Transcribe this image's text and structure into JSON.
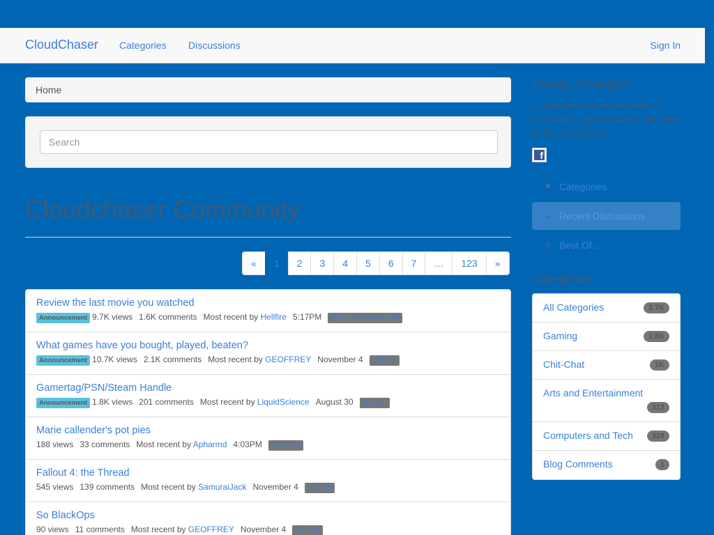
{
  "navbar": {
    "brand": "CloudChaser",
    "links": [
      "Categories",
      "Discussions"
    ],
    "signin": "Sign In"
  },
  "breadcrumb": "Home",
  "search": {
    "placeholder": "Search"
  },
  "page_title": "Cloudchaser Community",
  "pager": [
    "«",
    "1",
    "2",
    "3",
    "4",
    "5",
    "6",
    "7",
    "…",
    "123",
    "»"
  ],
  "discussions": [
    {
      "title": "Review the last movie you watched",
      "announcement": "Announcement",
      "views": "9.7K views",
      "comments": "1.6K comments",
      "recent_prefix": "Most recent by",
      "user": "Hellfire",
      "time": "5:17PM",
      "category": "Arts and Entertainment"
    },
    {
      "title": "What games have you bought, played, beaten?",
      "announcement": "Announcement",
      "views": "10.7K views",
      "comments": "2.1K comments",
      "recent_prefix": "Most recent by",
      "user": "GEOFFREY",
      "time": "November 4",
      "category": "Gaming"
    },
    {
      "title": "Gamertag/PSN/Steam Handle",
      "announcement": "Announcement",
      "views": "1.8K views",
      "comments": "201 comments",
      "recent_prefix": "Most recent by",
      "user": "LiquidScience",
      "time": "August 30",
      "category": "Gaming"
    },
    {
      "title": "Marie callender's pot pies",
      "announcement": "",
      "views": "188 views",
      "comments": "33 comments",
      "recent_prefix": "Most recent by",
      "user": "Apharmd",
      "time": "4:03PM",
      "category": "Chit-Chat"
    },
    {
      "title": "Fallout 4: the Thread",
      "announcement": "",
      "views": "545 views",
      "comments": "139 comments",
      "recent_prefix": "Most recent by",
      "user": "SamuraiJack",
      "time": "November 4",
      "category": "Gaming"
    },
    {
      "title": "So BlackOps",
      "announcement": "",
      "views": "90 views",
      "comments": "11 comments",
      "recent_prefix": "Most recent by",
      "user": "GEOFFREY",
      "time": "November 4",
      "category": "Gaming"
    }
  ],
  "sidebar": {
    "howdy": "Howdy, Stranger!",
    "intro": "It looks like you're new here. If you want to get involved, click one of these buttons!",
    "nav": [
      {
        "label": "Categories",
        "icon": "tags-icon"
      },
      {
        "label": "Recent Discussions",
        "icon": "comments-icon"
      },
      {
        "label": "Best Of...",
        "icon": "trophy-icon"
      }
    ],
    "categories_heading": "Categories",
    "categories": [
      {
        "name": "All Categories",
        "count": "3.7K"
      },
      {
        "name": "Gaming",
        "count": "1.8K"
      },
      {
        "name": "Chit-Chat",
        "count": "1K"
      },
      {
        "name": "Arts and Entertainment",
        "count": "312"
      },
      {
        "name": "Computers and Tech",
        "count": "328"
      },
      {
        "name": "Blog Comments",
        "count": "1"
      }
    ]
  }
}
